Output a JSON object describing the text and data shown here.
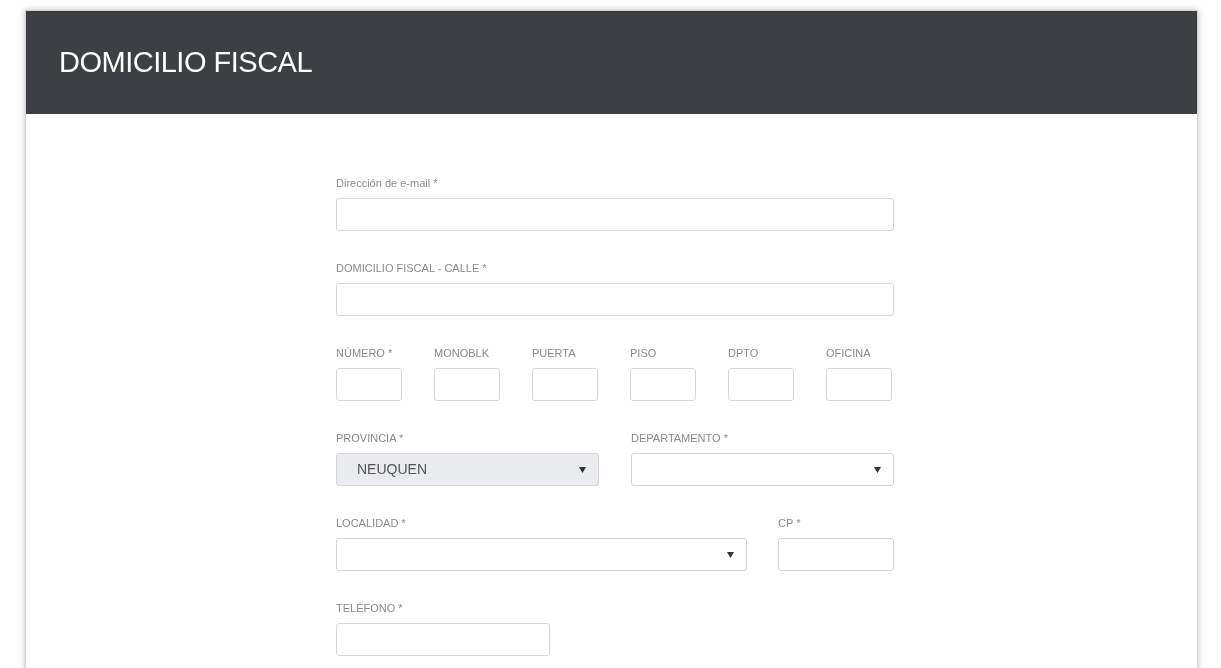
{
  "header": {
    "title": "DOMICILIO FISCAL"
  },
  "rows": [
    [
      {
        "label": "Dirección de e-mail *",
        "kind": "text"
      }
    ],
    [
      {
        "label": "DOMICILIO FISCAL - CALLE *",
        "kind": "text"
      }
    ],
    [
      {
        "label": "NÚMERO *",
        "kind": "text"
      },
      {
        "label": "MONOBLK",
        "kind": "text"
      },
      {
        "label": "PUERTA",
        "kind": "text"
      },
      {
        "label": "PISO",
        "kind": "text"
      },
      {
        "label": "DPTO",
        "kind": "text"
      },
      {
        "label": "OFICINA",
        "kind": "text"
      }
    ],
    [
      {
        "label": "PROVINCIA *",
        "kind": "select",
        "value": "NEUQUEN",
        "disabled": true
      },
      {
        "label": "DEPARTAMENTO *",
        "kind": "select",
        "disabled": false
      }
    ],
    [
      {
        "label": "LOCALIDAD *",
        "kind": "select",
        "disabled": false
      },
      {
        "label": "CP *",
        "kind": "text"
      }
    ],
    [
      {
        "label": "TELÉFONO *",
        "kind": "text"
      }
    ]
  ]
}
